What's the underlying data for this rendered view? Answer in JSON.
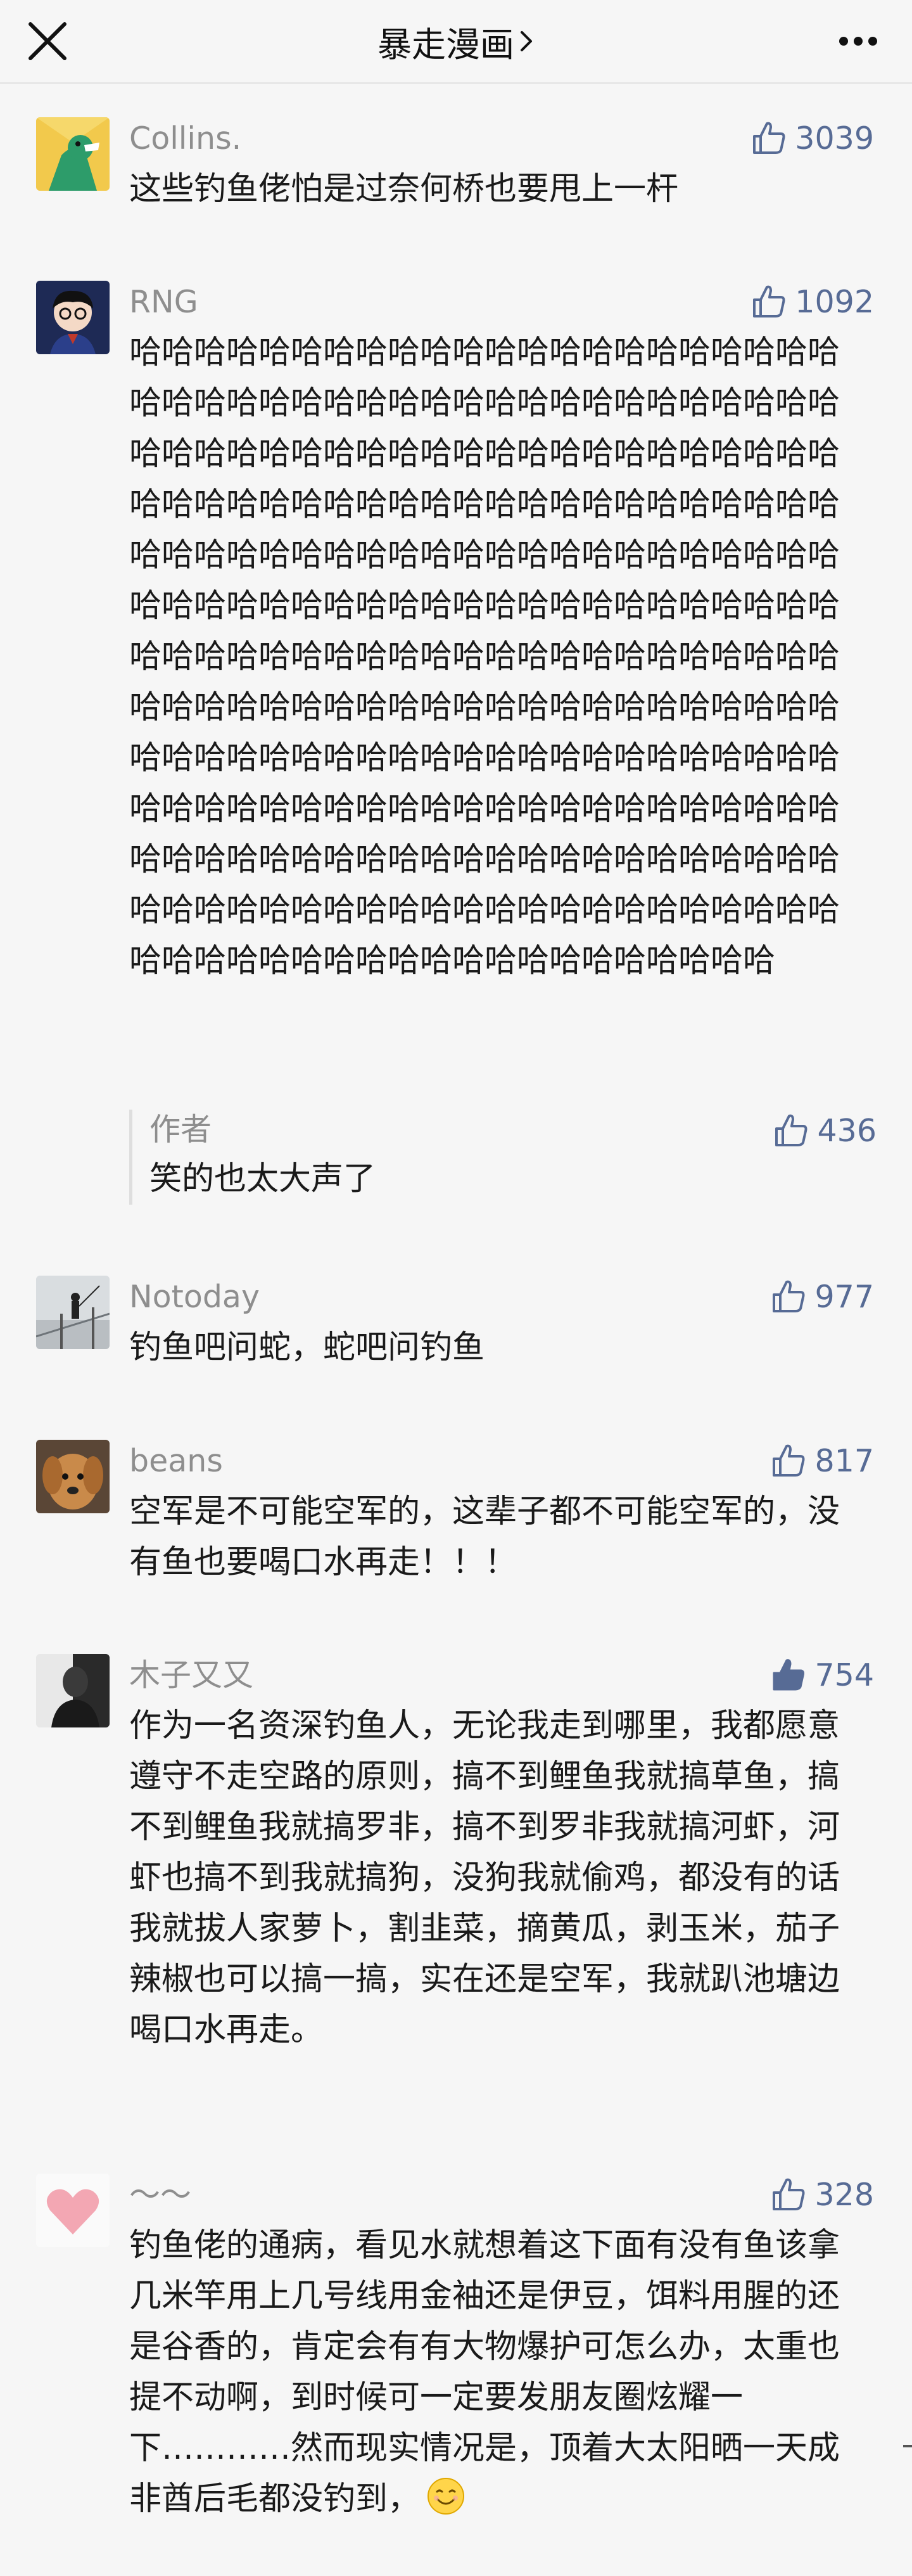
{
  "nav": {
    "title": "暴走漫画"
  },
  "comments": [
    {
      "nickname": "Collins.",
      "likes": "3039",
      "liked": false,
      "text": "这些钓鱼佬怕是过奈何桥也要甩上一杆"
    },
    {
      "nickname": "RNG",
      "likes": "1092",
      "liked": false,
      "text": "哈哈哈哈哈哈哈哈哈哈哈哈哈哈哈哈哈哈哈哈哈哈哈哈哈哈哈哈哈哈哈哈哈哈哈哈哈哈哈哈哈哈哈哈哈哈哈哈哈哈哈哈哈哈哈哈哈哈哈哈哈哈哈哈哈哈哈哈哈哈哈哈哈哈哈哈哈哈哈哈哈哈哈哈哈哈哈哈哈哈哈哈哈哈哈哈哈哈哈哈哈哈哈哈哈哈哈哈哈哈哈哈哈哈哈哈哈哈哈哈哈哈哈哈哈哈哈哈哈哈哈哈哈哈哈哈哈哈哈哈哈哈哈哈哈哈哈哈哈哈哈哈哈哈哈哈哈哈哈哈哈哈哈哈哈哈哈哈哈哈哈哈哈哈哈哈哈哈哈哈哈哈哈哈哈哈哈哈哈哈哈哈哈哈哈哈哈哈哈哈哈哈哈哈哈哈哈哈哈哈哈哈哈哈哈哈哈哈哈哈哈哈哈哈哈哈哈哈哈哈哈哈哈哈哈哈哈哈哈哈哈哈哈哈哈哈哈哈哈哈哈哈哈哈哈哈哈哈哈哈哈哈哈哈哈哈哈哈哈哈哈哈哈哈哈哈哈哈哈哈哈哈哈哈",
      "reply": {
        "name": "作者",
        "text": "笑的也太大声了",
        "likes": "436"
      }
    },
    {
      "nickname": "Notoday",
      "likes": "977",
      "liked": false,
      "text": "钓鱼吧问蛇，蛇吧问钓鱼"
    },
    {
      "nickname": "beans",
      "likes": "817",
      "liked": false,
      "text": "空军是不可能空军的，这辈子都不可能空军的，没有鱼也要喝口水再走！！！"
    },
    {
      "nickname": "木子又又",
      "likes": "754",
      "liked": true,
      "text": "作为一名资深钓鱼人，无论我走到哪里，我都愿意遵守不走空路的原则，搞不到鲤鱼我就搞草鱼，搞不到鲤鱼我就搞罗非，搞不到罗非我就搞河虾，河虾也搞不到我就搞狗，没狗我就偷鸡，都没有的话我就拔人家萝卜，割韭菜，摘黄瓜，剥玉米，茄子辣椒也可以搞一搞，实在还是空军，我就趴池塘边喝口水再走。"
    },
    {
      "nickname": "～～",
      "likes": "328",
      "liked": false,
      "text": "钓鱼佬的通病，看见水就想着这下面有没有鱼该拿几米竿用上几号线用金袖还是伊豆，饵料用腥的还是谷香的，肯定会有有大物爆护可怎么办，太重也提不动啊，到时候可一定要发朋友圈炫耀一下…………然而现实情况是，顶着大太阳晒一天成非酋后毛都没钓到，"
    }
  ],
  "colors": {
    "link_blue": "#576b95",
    "name_gray": "#8e8e8e",
    "background": "#f6f6f6"
  },
  "icons": [
    "close-icon",
    "chevron-right-icon",
    "more-icon",
    "thumbs-up-icon",
    "thumbs-up-filled-icon",
    "smile-emoji-icon"
  ]
}
